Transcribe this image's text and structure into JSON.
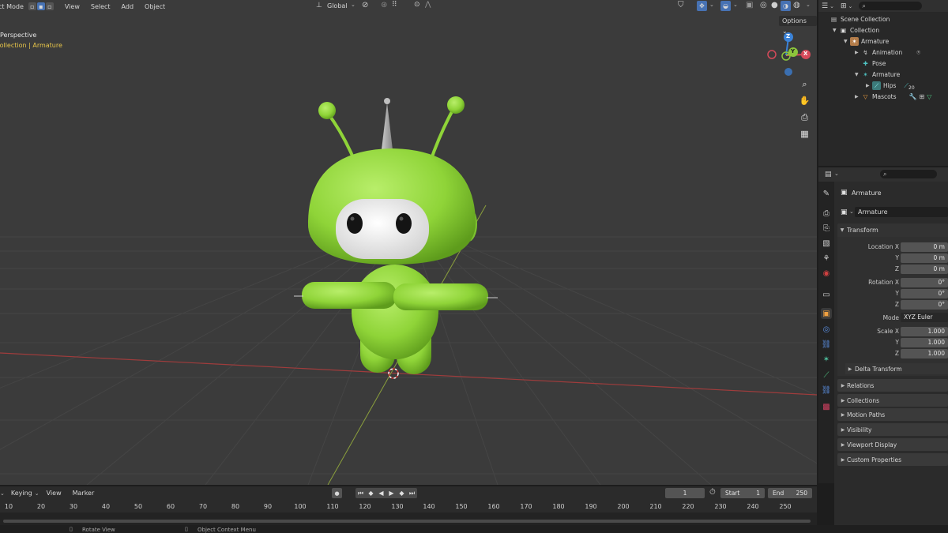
{
  "header": {
    "mode": "ct Mode",
    "menus": [
      "View",
      "Select",
      "Add",
      "Object"
    ],
    "orientation": "Global",
    "options_label": "Options"
  },
  "viewport": {
    "view_name": "Perspective",
    "collection_label": "Collection | Armature",
    "colors": {
      "background": "#3b3b3b",
      "grid": "#444444",
      "x_axis": "#a03c3c",
      "y_axis": "#8ba03c",
      "mascot": "#8fd438"
    },
    "gizmo_axes": [
      "Z",
      "Y",
      "X"
    ]
  },
  "outliner": {
    "items": [
      {
        "label": "Scene Collection",
        "icon": "scene-collection-icon"
      },
      {
        "label": "Collection",
        "icon": "collection-icon"
      },
      {
        "label": "Armature",
        "icon": "armature-icon"
      },
      {
        "label": "Animation",
        "icon": "animation-icon"
      },
      {
        "label": "Pose",
        "icon": "pose-icon"
      },
      {
        "label": "Armature",
        "icon": "armature-data-icon"
      },
      {
        "label": "Hips",
        "icon": "bone-icon"
      },
      {
        "label": "Mascots",
        "icon": "mesh-icon"
      }
    ],
    "hips_badge": "20"
  },
  "properties": {
    "object_name": "Armature",
    "datablock_name": "Armature",
    "transform_label": "Transform",
    "location": {
      "label": "Location X",
      "x": "0 m",
      "y": "0 m",
      "z": "0 m"
    },
    "rotation": {
      "label": "Rotation X",
      "x": "0°",
      "y": "0°",
      "z": "0°"
    },
    "mode": {
      "label": "Mode",
      "value": "XYZ Euler"
    },
    "scale": {
      "label": "Scale X",
      "x": "1.000",
      "y": "1.000",
      "z": "1.000"
    },
    "axis_y": "Y",
    "axis_z": "Z",
    "delta_transform": "Delta Transform",
    "panels": [
      "Relations",
      "Collections",
      "Motion Paths",
      "Visibility",
      "Viewport Display",
      "Custom Properties"
    ]
  },
  "timeline": {
    "menus": [
      "Keying",
      "View",
      "Marker"
    ],
    "current_frame": "1",
    "start_label": "Start",
    "start_value": "1",
    "end_label": "End",
    "end_value": "250",
    "ticks": [
      "10",
      "20",
      "30",
      "40",
      "50",
      "60",
      "70",
      "80",
      "90",
      "100",
      "110",
      "120",
      "130",
      "140",
      "150",
      "160",
      "170",
      "180",
      "190",
      "200",
      "210",
      "220",
      "230",
      "240",
      "250"
    ]
  },
  "statusbar": {
    "items": [
      "Rotate View",
      "Object Context Menu"
    ]
  }
}
